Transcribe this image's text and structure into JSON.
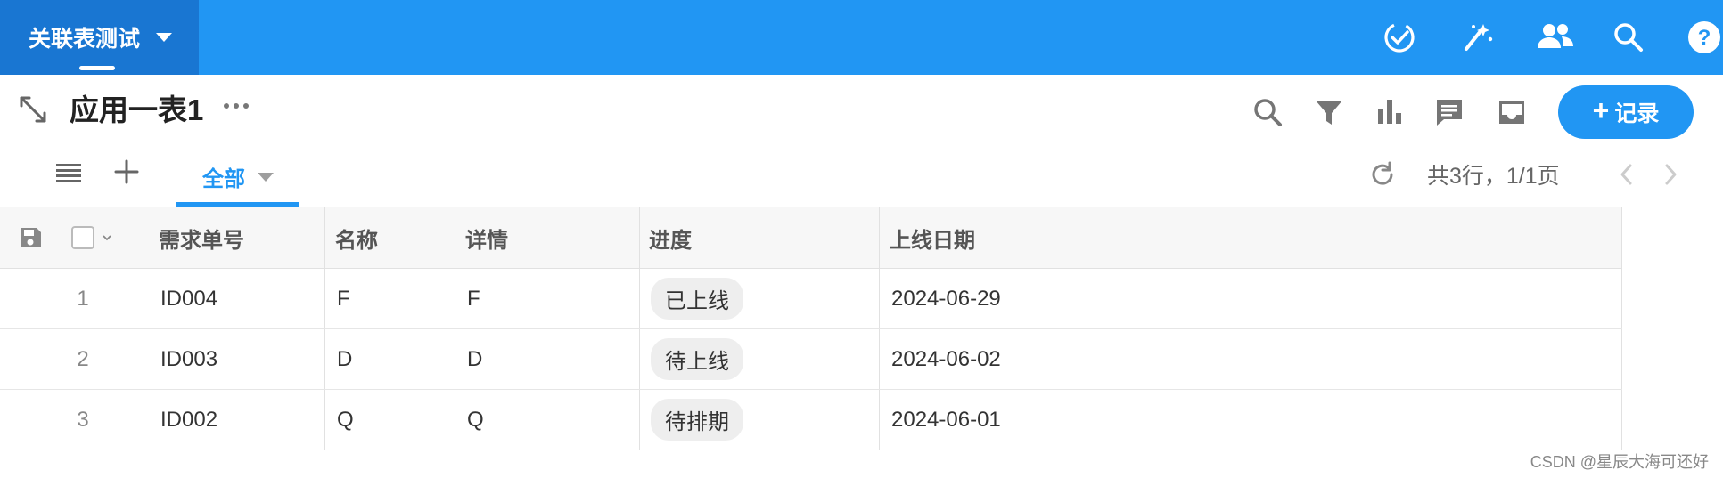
{
  "app": {
    "name": "关联表测试",
    "watermark": "CSDN @星辰大海可还好"
  },
  "topbar": {
    "icons": [
      "check-circle-icon",
      "magic-wand-icon",
      "group-icon",
      "search-icon",
      "help-icon"
    ],
    "help_label": "?"
  },
  "header": {
    "title": "应用一表1",
    "more_label": "···",
    "icons": [
      "search-icon",
      "filter-icon",
      "bar-chart-icon",
      "comment-icon",
      "inbox-icon"
    ],
    "record_button": {
      "plus": "+",
      "label": "记录"
    }
  },
  "views": {
    "active_tab": "全部",
    "pager": "共3行，1/1页"
  },
  "table": {
    "columns": [
      "需求单号",
      "名称",
      "详情",
      "进度",
      "上线日期"
    ],
    "rows": [
      {
        "num": "1",
        "id": "ID004",
        "name": "F",
        "detail": "F",
        "progress": "已上线",
        "date": "2024-06-29"
      },
      {
        "num": "2",
        "id": "ID003",
        "name": "D",
        "detail": "D",
        "progress": "待上线",
        "date": "2024-06-02"
      },
      {
        "num": "3",
        "id": "ID002",
        "name": "Q",
        "detail": "Q",
        "progress": "待排期",
        "date": "2024-06-01"
      }
    ]
  },
  "colors": {
    "primary": "#2196f3",
    "app_tab_bg": "#1976d2",
    "tag_bg": "#eeeeee"
  }
}
